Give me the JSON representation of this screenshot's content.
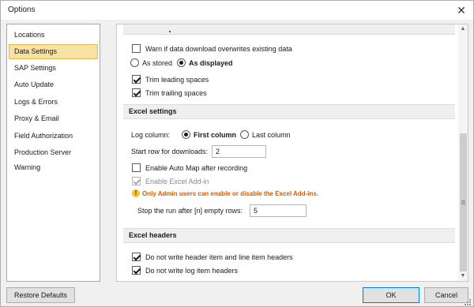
{
  "window": {
    "title": "Options",
    "close_glyph": "✕"
  },
  "sidebar": {
    "items": [
      {
        "label": "Locations",
        "selected": false
      },
      {
        "label": "Data Settings",
        "selected": true
      },
      {
        "label": "SAP Settings",
        "selected": false
      },
      {
        "label": "Auto Update",
        "selected": false
      },
      {
        "label": "Logs & Errors",
        "selected": false
      },
      {
        "label": "Proxy & Email",
        "selected": false
      },
      {
        "label": "Field Authorization",
        "selected": false
      },
      {
        "label": "Production Server Warning",
        "selected": false
      }
    ]
  },
  "data_download": {
    "warn_overwrite": {
      "label": "Warn if data download overwrites existing data",
      "checked": false
    },
    "format": {
      "as_stored_label": "As stored",
      "as_displayed_label": "As displayed",
      "selected": "As displayed"
    },
    "trim_leading": {
      "label": "Trim leading spaces",
      "checked": true
    },
    "trim_trailing": {
      "label": "Trim trailing spaces",
      "checked": true
    }
  },
  "excel_settings": {
    "header": "Excel settings",
    "log_column": {
      "label": "Log column:",
      "first_label": "First column",
      "last_label": "Last column",
      "selected": "First column"
    },
    "start_row": {
      "label": "Start row for downloads:",
      "value": "2"
    },
    "auto_map": {
      "label": "Enable Auto Map after recording",
      "checked": false
    },
    "excel_addin": {
      "label": "Enable Excel Add-in",
      "checked": true,
      "enabled": false
    },
    "admin_note": "Only Admin users can enable or disable the Excel Add-ins.",
    "stop_run": {
      "label": "Stop the run after [n] empty rows:",
      "value": "5"
    }
  },
  "excel_headers": {
    "header": "Excel headers",
    "no_header_item": {
      "label": "Do not write header item and line item headers",
      "checked": true
    },
    "no_log_item": {
      "label": "Do not write log item headers",
      "checked": true
    }
  },
  "footer": {
    "restore_label": "Restore Defaults",
    "ok_label": "OK",
    "cancel_label": "Cancel"
  },
  "icons": {
    "warning": "warning-icon",
    "scroll_up": "▲",
    "scroll_down": "▼"
  },
  "colors": {
    "selected_bg": "#f7e2a6",
    "selected_border": "#e2b94c",
    "warning_text": "#d65a00",
    "ok_border": "#0078d7"
  }
}
